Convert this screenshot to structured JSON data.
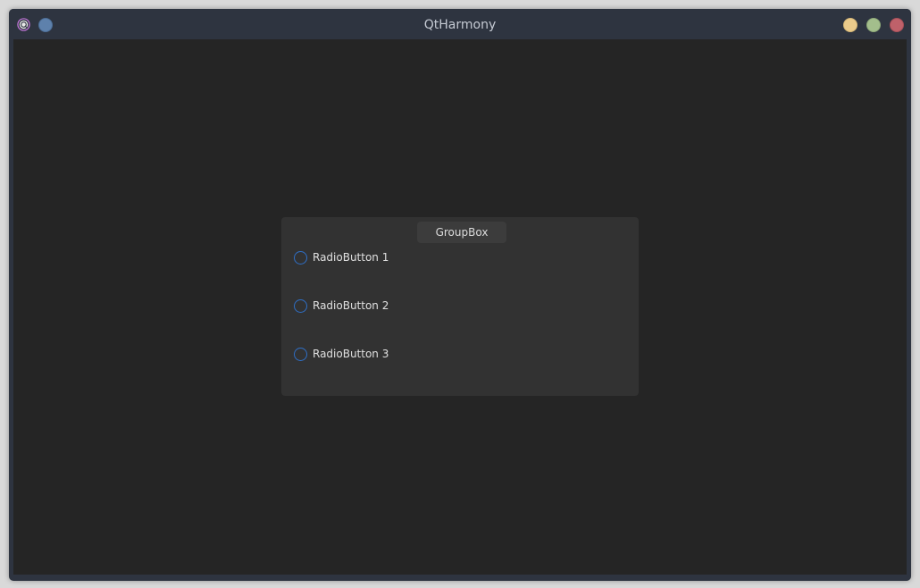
{
  "window": {
    "title": "QtHarmony"
  },
  "titlebar": {
    "app_icon": "qt-app-icon",
    "left_button_icon": "pin-icon",
    "controls": [
      "minimize-icon",
      "maximize-icon",
      "close-icon"
    ]
  },
  "groupbox": {
    "title": "GroupBox",
    "radio_buttons": [
      {
        "label": "RadioButton 1",
        "checked": false
      },
      {
        "label": "RadioButton 2",
        "checked": false
      },
      {
        "label": "RadioButton 3",
        "checked": false
      }
    ]
  },
  "colors": {
    "titlebar": "#2e3440",
    "background": "#252525",
    "groupbox": "#323232",
    "accent": "#2f6fc6",
    "minimize": "#ebcb8b",
    "maximize": "#a3be8c",
    "close": "#bf616a"
  }
}
